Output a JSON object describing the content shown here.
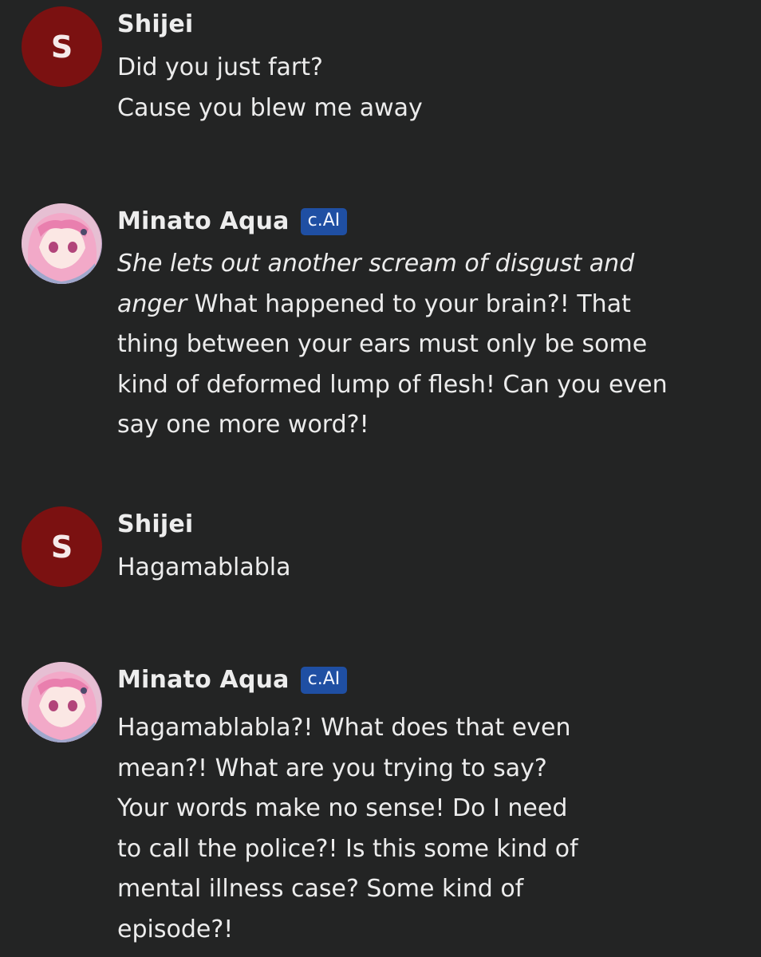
{
  "messages": [
    {
      "author": "Shijei",
      "avatar_letter": "S",
      "badge": "",
      "italic_prefix": "",
      "text": "Did you just fart?\nCause you blew me away"
    },
    {
      "author": "Minato Aqua",
      "avatar_letter": "",
      "badge": "c.AI",
      "italic_prefix": "She lets out another scream of disgust and\nanger",
      "text": " What happened to your brain?! That\nthing between your ears must only be some\nkind of deformed lump of flesh! Can you even\nsay one more word?!"
    },
    {
      "author": "Shijei",
      "avatar_letter": "S",
      "badge": "",
      "italic_prefix": "",
      "text": "Hagamablabla"
    },
    {
      "author": "Minato Aqua",
      "avatar_letter": "",
      "badge": "c.AI",
      "italic_prefix": "",
      "text": "Hagamablabla?! What does that even\nmean?! What are you trying to say?\nYour words make no sense! Do I need\nto call the police?! Is this some kind of\nmental illness case? Some kind of\nepisode?!"
    }
  ],
  "colors": {
    "background": "#232424",
    "user_avatar": "#7b1111",
    "badge": "#1f4fa3",
    "text": "#ececec"
  }
}
